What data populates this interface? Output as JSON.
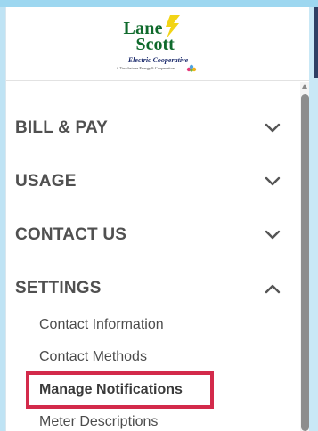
{
  "logo": {
    "line1": "Lane",
    "line2": "Scott",
    "subtitle": "Electric Cooperative",
    "tagline": "A Touchstone Energy® Cooperative"
  },
  "menu": {
    "bill_pay": "BILL & PAY",
    "usage": "USAGE",
    "contact_us": "CONTACT US",
    "settings": "SETTINGS"
  },
  "settings_submenu": {
    "contact_information": "Contact Information",
    "contact_methods": "Contact Methods",
    "manage_notifications": "Manage Notifications",
    "meter_descriptions": "Meter Descriptions"
  },
  "colors": {
    "logo_green": "#0f6a2c",
    "logo_yellow": "#f2d416",
    "highlight_red": "#d32a4b",
    "menu_text": "#505050"
  },
  "icons": {
    "collapsed": "chevron-down-icon",
    "expanded": "chevron-up-icon"
  }
}
